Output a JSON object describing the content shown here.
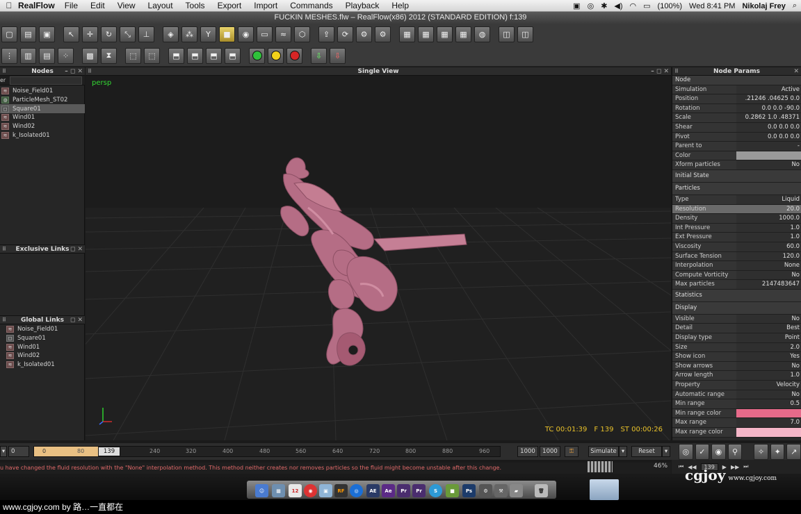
{
  "menubar": {
    "app": "RealFlow",
    "items": [
      "File",
      "Edit",
      "View",
      "Layout",
      "Tools",
      "Export",
      "Import",
      "Commands",
      "Playback",
      "Help"
    ],
    "battery": "(100%)",
    "datetime": "Wed 8:41 PM",
    "user": "Nikolaj Frey"
  },
  "window_title": "FUCKIN MESHES.flw – RealFlow(x86) 2012 (STANDARD EDITION) f:139",
  "panels": {
    "nodes_title": "Nodes",
    "filter_label": "er",
    "exclusive_title": "Exclusive Links",
    "global_title": "Global Links",
    "viewport_title": "Single View",
    "params_title": "Node Params"
  },
  "nodes": [
    {
      "name": "Noise_Field01",
      "selected": false
    },
    {
      "name": "ParticleMesh_ST02",
      "selected": false
    },
    {
      "name": "Square01",
      "selected": true
    },
    {
      "name": "Wind01",
      "selected": false
    },
    {
      "name": "Wind02",
      "selected": false
    },
    {
      "name": "k_Isolated01",
      "selected": false
    }
  ],
  "global_links": [
    "Noise_Field01",
    "Square01",
    "Wind01",
    "Wind02",
    "k_Isolated01"
  ],
  "viewport": {
    "camera": "persp",
    "tc": "TC 00:01:39",
    "frame": "F 139",
    "st": "ST 00:00:26"
  },
  "params": {
    "node_section": "Node",
    "rows_node": [
      {
        "k": "Simulation",
        "v": "Active"
      },
      {
        "k": "Position",
        "v": ".21246  .04625     0.0"
      },
      {
        "k": "Rotation",
        "v": "0.0     0.0   -90.0"
      },
      {
        "k": "Scale",
        "v": "0.2862     1.0  .48371"
      },
      {
        "k": "Shear",
        "v": "0.0     0.0     0.0"
      },
      {
        "k": "Pivot",
        "v": "0.0     0.0     0.0"
      },
      {
        "k": "Parent to",
        "v": "-"
      },
      {
        "k": "Color",
        "v": ""
      },
      {
        "k": "Xform particles",
        "v": "No"
      }
    ],
    "initial_state": "Initial State",
    "particles_section": "Particles",
    "rows_particles": [
      {
        "k": "Type",
        "v": "Liquid"
      },
      {
        "k": "Resolution",
        "v": "20.0"
      },
      {
        "k": "Density",
        "v": "1000.0"
      },
      {
        "k": "Int Pressure",
        "v": "1.0"
      },
      {
        "k": "Ext Pressure",
        "v": "1.0"
      },
      {
        "k": "Viscosity",
        "v": "60.0"
      },
      {
        "k": "Surface Tension",
        "v": "120.0"
      },
      {
        "k": "Interpolation",
        "v": "None"
      },
      {
        "k": "Compute Vorticity",
        "v": "No"
      },
      {
        "k": "Max particles",
        "v": "2147483647"
      }
    ],
    "statistics": "Statistics",
    "display_section": "Display",
    "rows_display": [
      {
        "k": "Visible",
        "v": "No"
      },
      {
        "k": "Detail",
        "v": "Best"
      },
      {
        "k": "Display type",
        "v": "Point"
      },
      {
        "k": "Size",
        "v": "2.0"
      },
      {
        "k": "Show icon",
        "v": "Yes"
      },
      {
        "k": "Show arrows",
        "v": "No"
      },
      {
        "k": "Arrow length",
        "v": "1.0"
      },
      {
        "k": "Property",
        "v": "Velocity"
      },
      {
        "k": "Automatic range",
        "v": "No"
      },
      {
        "k": "Min range",
        "v": "0.5"
      },
      {
        "k": "Min range color",
        "v": ""
      },
      {
        "k": "Max range",
        "v": "7.0"
      },
      {
        "k": "Max range color",
        "v": ""
      }
    ]
  },
  "timeline": {
    "start": "0",
    "range_start": "0",
    "current": "139",
    "ticks": [
      "80",
      "240",
      "320",
      "400",
      "480",
      "560",
      "640",
      "720",
      "800",
      "880",
      "960"
    ],
    "end1": "1000",
    "end2": "1000",
    "simulate": "Simulate",
    "reset": "Reset",
    "percent": "46%",
    "frame_field": "139"
  },
  "status_message": "u have changed the fluid resolution  with the \"None\" interpolation method. This method  neither creates nor removes particles so the  fluid might become unstable after this change.",
  "footer": "www.cgjoy.com by 路…一直都在",
  "watermark": {
    "brand": "cgjoy",
    "url": "www.cgjoy.com"
  },
  "colors": {
    "mesh": "#b56d85",
    "min_range_color": "#e66a8a",
    "max_range_color": "#f5b6c8",
    "timeline_fill": "#e9c083",
    "status_text": "#e26a6a",
    "hud_text": "#e8c12a"
  }
}
